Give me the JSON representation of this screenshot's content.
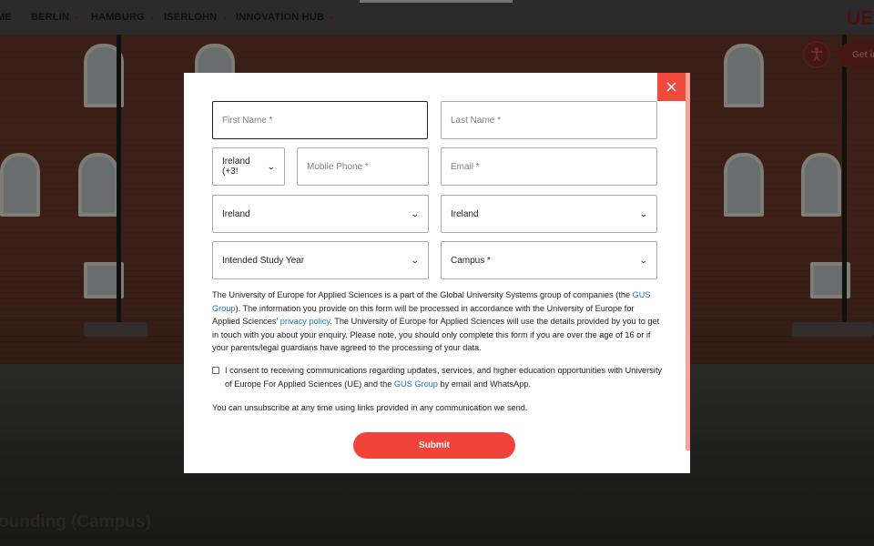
{
  "nav": {
    "items": [
      "ME",
      "BERLIN",
      "HAMBURG",
      "ISERLOHN",
      "INNOVATION HUB"
    ],
    "logo": "UE",
    "get_in_label": "Get in"
  },
  "background": {
    "caption": "ounding (Campus)"
  },
  "form": {
    "first_name_placeholder": "First Name *",
    "last_name_placeholder": "Last Name *",
    "phone_country": "Ireland (+3!",
    "mobile_placeholder": "Mobile Phone *",
    "email_placeholder": "Email *",
    "country_1": "Ireland",
    "country_2": "Ireland",
    "study_year": "Intended Study Year",
    "campus": "Campus *",
    "notice_1": "The University of Europe for Applied Sciences is a part of the Global University Systems group of companies (the ",
    "notice_link_1": "GUS Group",
    "notice_2": "). The information you provide on this form will be processed in accordance with the University of Europe for Applied Sciences' ",
    "notice_link_2": "privacy policy",
    "notice_3": ". The University of Europe for Applied Sciences will use the details provided by you to get in touch with you about your enquiry. Please note, you should only complete this form if you are over the age of 16 or if your parents/legal guardians have agreed to the processing of your data.",
    "consent_1": "I consent to receiving communications regarding updates, services, and higher education opportunities with University of Europe For Applied Sciences (UE) and the ",
    "consent_link": "GUS Group",
    "consent_2": " by email and WhatsApp.",
    "unsubscribe": "You can unsubscribe at any time using links provided in any communication we send.",
    "submit_label": "Submit"
  },
  "icons": {
    "close": "close-icon",
    "chevron": "chevron-down-icon",
    "accessibility": "accessibility-icon"
  },
  "colors": {
    "accent": "#f0443a",
    "link": "#1d72c2"
  }
}
